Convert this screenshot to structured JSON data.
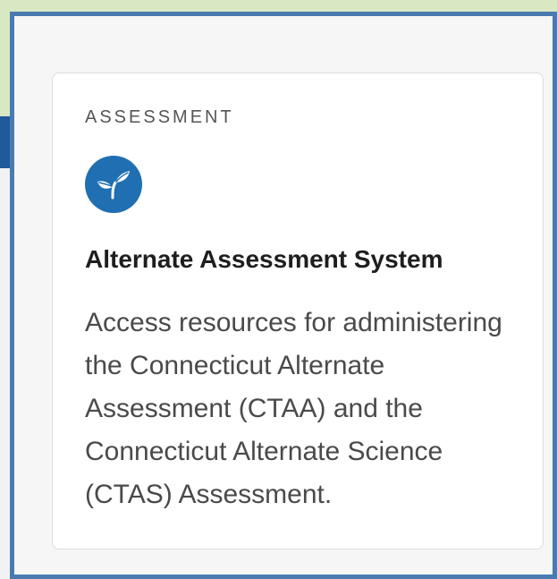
{
  "card": {
    "category": "ASSESSMENT",
    "icon": "sprout-icon",
    "title": "Alternate Assessment System",
    "description": "Access resources for administering the Connecticut Alternate Assessment (CTAA) and the Connecticut Alternate Science (CTAS) Assessment."
  },
  "colors": {
    "accent": "#1f6fb2",
    "overlay_border": "#4a7bb0",
    "background_green": "#d8e8c3",
    "title": "#1e1e1e",
    "body_text": "#4a4a4a"
  }
}
